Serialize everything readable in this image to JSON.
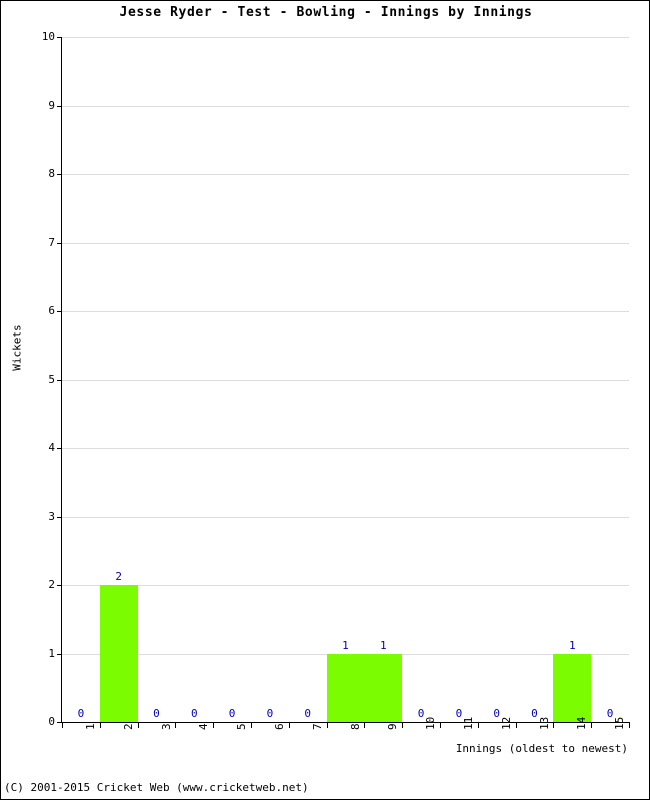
{
  "title": "Jesse Ryder - Test - Bowling - Innings by Innings",
  "footer": {
    "copyright": "(C) 2001-2015 Cricket Web (www.cricketweb.net)"
  },
  "colors": {
    "bar": "#7CFC00",
    "value_label": "#0000BB",
    "gridline": "#DDDDDD",
    "axis": "#000000",
    "background": "#FFFFFF"
  },
  "chart_data": {
    "type": "bar",
    "title": "Jesse Ryder - Test - Bowling - Innings by Innings",
    "xlabel": "Innings (oldest to newest)",
    "ylabel": "Wickets",
    "categories": [
      "1",
      "2",
      "3",
      "4",
      "5",
      "6",
      "7",
      "8",
      "9",
      "10",
      "11",
      "12",
      "13",
      "14",
      "15"
    ],
    "values": [
      0,
      2,
      0,
      0,
      0,
      0,
      0,
      1,
      1,
      0,
      0,
      0,
      0,
      1,
      0
    ],
    "value_labels": [
      "0",
      "2",
      "0",
      "0",
      "0",
      "0",
      "0",
      "1",
      "1",
      "0",
      "0",
      "0",
      "0",
      "1",
      "0"
    ],
    "ylim": [
      0,
      10
    ],
    "ytick_labels": [
      "0",
      "1",
      "2",
      "3",
      "4",
      "5",
      "6",
      "7",
      "8",
      "9",
      "10"
    ],
    "yticks": [
      0,
      1,
      2,
      3,
      4,
      5,
      6,
      7,
      8,
      9,
      10
    ],
    "grid": true,
    "legend": false
  }
}
